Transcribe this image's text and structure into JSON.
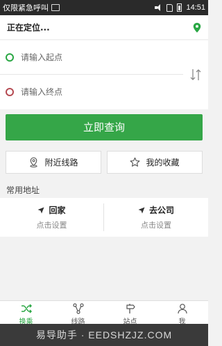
{
  "status_bar": {
    "carrier_text": "仅限紧急呼叫",
    "time": "14:51"
  },
  "location_bar": {
    "status_text": "正在定位...",
    "icon": "location-pin-icon"
  },
  "route": {
    "start_placeholder": "请输入起点",
    "end_placeholder": "请输入终点",
    "swap_icon": "swap-icon"
  },
  "query_button": "立即查询",
  "quick_actions": {
    "nearby_label": "附近线路",
    "favorites_label": "我的收藏"
  },
  "common_address": {
    "title": "常用地址",
    "home": {
      "label": "回家",
      "sub": "点击设置"
    },
    "work": {
      "label": "去公司",
      "sub": "点击设置"
    }
  },
  "tabs": [
    {
      "label": "换乘",
      "icon": "transfer-icon",
      "active": true
    },
    {
      "label": "线路",
      "icon": "route-icon",
      "active": false
    },
    {
      "label": "站点",
      "icon": "station-sign-icon",
      "active": false
    },
    {
      "label": "我",
      "icon": "person-icon",
      "active": false
    }
  ],
  "watermark": "易导助手 · EEDSHZJZ.COM",
  "colors": {
    "accent": "#35a648",
    "start_dot": "#2aa744",
    "end_dot": "#b54a52"
  }
}
